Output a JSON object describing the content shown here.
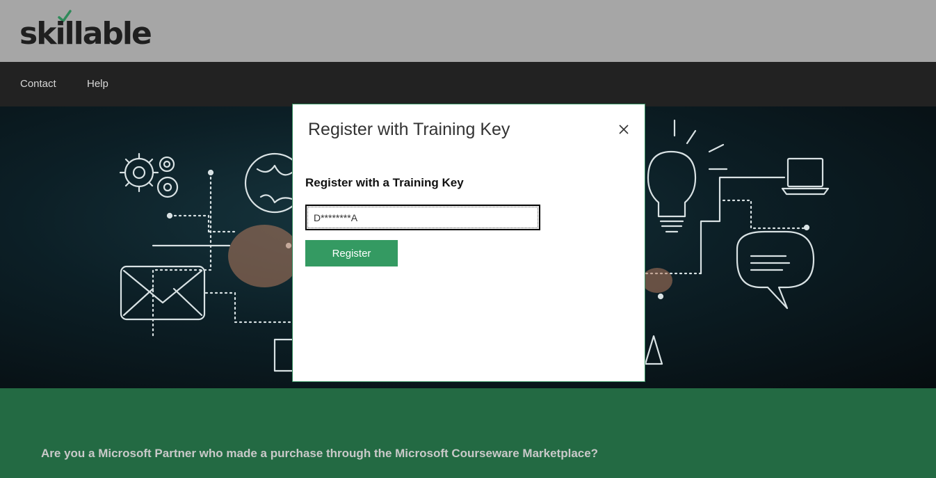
{
  "brand": {
    "logo_text": "skillable",
    "accent": "#2f8a5a"
  },
  "nav": {
    "items": [
      {
        "label": "Contact"
      },
      {
        "label": "Help"
      }
    ]
  },
  "modal": {
    "title": "Register with Training Key",
    "close_icon": "close-icon",
    "section_heading": "Register with a Training Key",
    "key_value": "D********A",
    "register_label": "Register"
  },
  "banner": {
    "question": "Are you a Microsoft Partner who made a purchase through the Microsoft Courseware Marketplace?"
  },
  "colors": {
    "topbar": "#a6a6a6",
    "navbar": "#222222",
    "green_band": "#236a43",
    "button": "#349a62"
  }
}
